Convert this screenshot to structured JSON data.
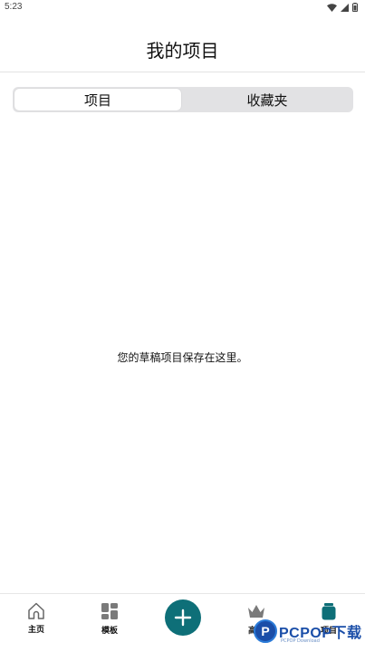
{
  "status_bar": {
    "time": "5:23",
    "icons": [
      "wifi-icon",
      "signal-icon",
      "battery-icon"
    ]
  },
  "header": {
    "title": "我的项目"
  },
  "tabs": [
    {
      "label": "项目",
      "selected": true
    },
    {
      "label": "收藏夹",
      "selected": false
    }
  ],
  "empty_state": {
    "message": "您的草稿项目保存在这里。"
  },
  "bottom_nav": {
    "home_label": "主页",
    "templates_label": "模板",
    "premium_label": "高级",
    "projects_label": "项目",
    "add_icon": "plus-icon"
  },
  "watermark": {
    "text": "PCPOP下载",
    "logo_letter": "P",
    "subtext": "PCPOP Download"
  },
  "colors": {
    "accent": "#0e6f78",
    "tab_bg": "#e2e2e4",
    "watermark": "#1a4ea8"
  }
}
